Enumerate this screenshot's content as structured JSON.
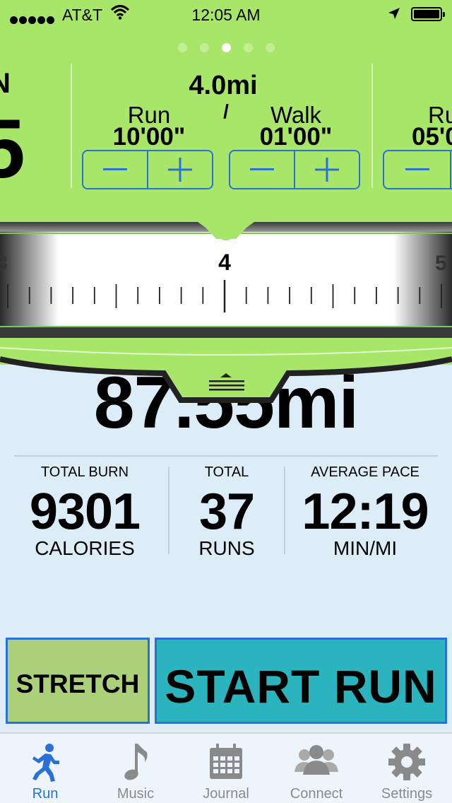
{
  "status_bar": {
    "carrier": "AT&T",
    "time": "12:05 AM"
  },
  "colors": {
    "green": "#a8e66a",
    "blue": "#2a71d6",
    "start_teal": "#2bb3be",
    "stretch_green": "#acd07a",
    "background": "#dcedf8"
  },
  "intervals": {
    "page_count": 5,
    "active_page": 3,
    "left_partial": {
      "label": "N",
      "value": "5"
    },
    "center": {
      "distance": "4.0mi",
      "separator": "/",
      "run_label": "Run",
      "run_value": "10'00\"",
      "walk_label": "Walk",
      "walk_value": "01'00\""
    },
    "right_partial": {
      "label": "Ru",
      "value": "05'0"
    },
    "minus_icon": "minus-icon",
    "plus_icon": "plus-icon"
  },
  "ruler": {
    "labels": [
      "3",
      "4",
      "5"
    ],
    "selected": 4
  },
  "stats": {
    "total_distance": "87.55mi",
    "items": [
      {
        "top": "TOTAL BURN",
        "value": "9301",
        "unit": "CALORIES"
      },
      {
        "top": "TOTAL",
        "value": "37",
        "unit": "RUNS"
      },
      {
        "top": "AVERAGE PACE",
        "value": "12:19",
        "unit": "MIN/MI"
      }
    ]
  },
  "buttons": {
    "stretch": "STRETCH",
    "start": "START RUN"
  },
  "tabs": [
    {
      "label": "Run",
      "icon": "runner-icon",
      "active": true
    },
    {
      "label": "Music",
      "icon": "music-note-icon",
      "active": false
    },
    {
      "label": "Journal",
      "icon": "calendar-icon",
      "active": false
    },
    {
      "label": "Connect",
      "icon": "people-icon",
      "active": false
    },
    {
      "label": "Settings",
      "icon": "gear-icon",
      "active": false
    }
  ]
}
